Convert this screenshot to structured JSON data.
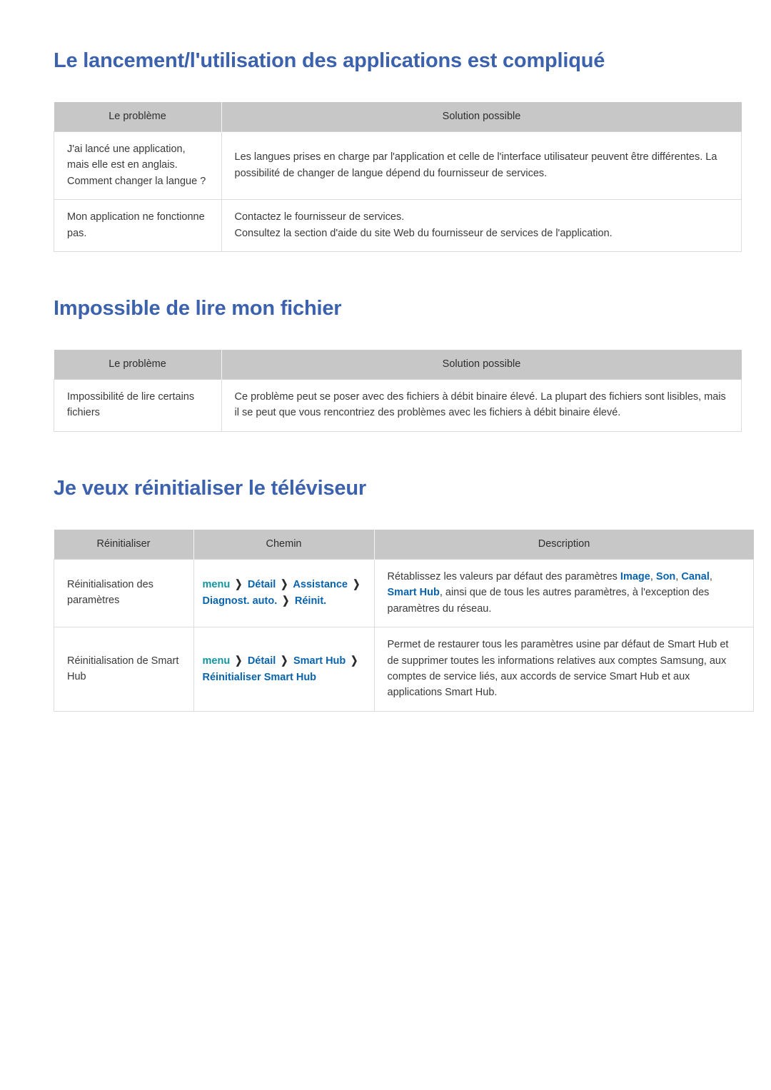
{
  "sections": [
    {
      "heading": "Le lancement/l'utilisation des applications est compliqué",
      "table": {
        "headers": [
          "Le problème",
          "Solution possible"
        ],
        "rows": [
          {
            "problem": "J'ai lancé une application, mais elle est en anglais. Comment changer la langue ?",
            "solution_lines": [
              "Les langues prises en charge par l'application et celle de l'interface utilisateur peuvent être différentes. La possibilité de changer de langue dépend du fournisseur de services."
            ]
          },
          {
            "problem": "Mon application ne fonctionne pas.",
            "solution_lines": [
              "Contactez le fournisseur de services.",
              "Consultez la section d'aide du site Web du fournisseur de services de l'application."
            ]
          }
        ]
      }
    },
    {
      "heading": "Impossible de lire mon fichier",
      "table": {
        "headers": [
          "Le problème",
          "Solution possible"
        ],
        "rows": [
          {
            "problem": "Impossibilité de lire certains fichiers",
            "solution_lines": [
              "Ce problème peut se poser avec des fichiers à débit binaire élevé. La plupart des fichiers sont lisibles, mais il se peut que vous rencontriez des problèmes avec les fichiers à débit binaire élevé."
            ]
          }
        ]
      }
    },
    {
      "heading": "Je veux réinitialiser le téléviseur",
      "table": {
        "headers": [
          "Réinitialiser",
          "Chemin",
          "Description"
        ],
        "rows": [
          {
            "reset": "Réinitialisation des paramètres",
            "path_tokens": [
              "menu",
              "Détail",
              "Assistance",
              "Diagnost. auto.",
              "Réinit."
            ],
            "description_parts": [
              {
                "text": "Rétablissez les valeurs par défaut des paramètres ",
                "highlight": false
              },
              {
                "text": "Image",
                "highlight": true
              },
              {
                "text": ", ",
                "highlight": false
              },
              {
                "text": "Son",
                "highlight": true
              },
              {
                "text": ", ",
                "highlight": false
              },
              {
                "text": "Canal",
                "highlight": true
              },
              {
                "text": ", ",
                "highlight": false
              },
              {
                "text": "Smart Hub",
                "highlight": true
              },
              {
                "text": ", ainsi que de tous les autres paramètres, à l'exception des paramètres du réseau.",
                "highlight": false
              }
            ]
          },
          {
            "reset": "Réinitialisation de Smart Hub",
            "path_tokens": [
              "menu",
              "Détail",
              "Smart Hub",
              "Réinitialiser Smart Hub"
            ],
            "description_parts": [
              {
                "text": "Permet de restaurer tous les paramètres usine par défaut de Smart Hub et de supprimer toutes les informations relatives aux comptes Samsung, aux comptes de service liés, aux accords de service Smart Hub et aux applications Smart Hub.",
                "highlight": false
              }
            ]
          }
        ]
      }
    }
  ],
  "icons": {
    "chevron": "❯"
  },
  "colors": {
    "heading_blue": "#3d62ad",
    "header_gray": "#c7c7c7",
    "menu_teal": "#13959f",
    "menu_blue": "#0a63ad",
    "body_text": "#3a3a3a"
  }
}
